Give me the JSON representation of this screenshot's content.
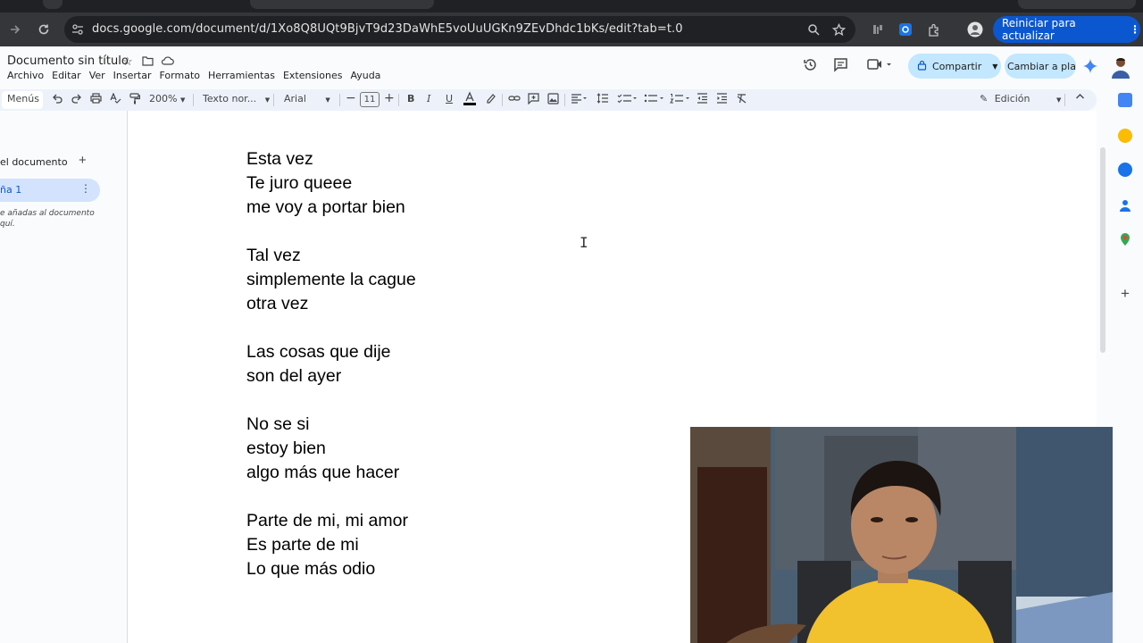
{
  "browser": {
    "url": "docs.google.com/document/d/1Xo8Q8UQt9BjvT9d23DaWhE5voUuUGKn9ZEvDhdc1bKs/edit?tab=t.0",
    "update_button": "Reiniciar para actualizar"
  },
  "doc": {
    "title": "Documento sin título",
    "menus": [
      "Archivo",
      "Editar",
      "Ver",
      "Insertar",
      "Formato",
      "Herramientas",
      "Extensiones",
      "Ayuda"
    ],
    "share_label": "Compartir",
    "switch_label": "Cambiar a pla..."
  },
  "toolbar": {
    "menus_label": "Menús",
    "zoom": "200%",
    "style": "Texto nor...",
    "font": "Arial",
    "font_size": "11",
    "mode": "Edición"
  },
  "outline": {
    "title": "el documento",
    "tab_label": "ña 1",
    "hint": "e añadas al documento\nquí."
  },
  "lyrics": [
    "Esta vez",
    "Te juro queee",
    "me voy a portar bien",
    "",
    "Tal vez",
    "simplemente la cague",
    "otra vez",
    "",
    "Las cosas que dije",
    "son del ayer",
    "",
    "No se si",
    "estoy bien",
    "algo más que hacer",
    "",
    "Parte de mi, mi amor",
    "Es parte de mi",
    "Lo que más odio"
  ],
  "colors": {
    "accent": "#0b57d0",
    "share_bg": "#c2e7ff",
    "chrome_dark": "#35363a"
  }
}
